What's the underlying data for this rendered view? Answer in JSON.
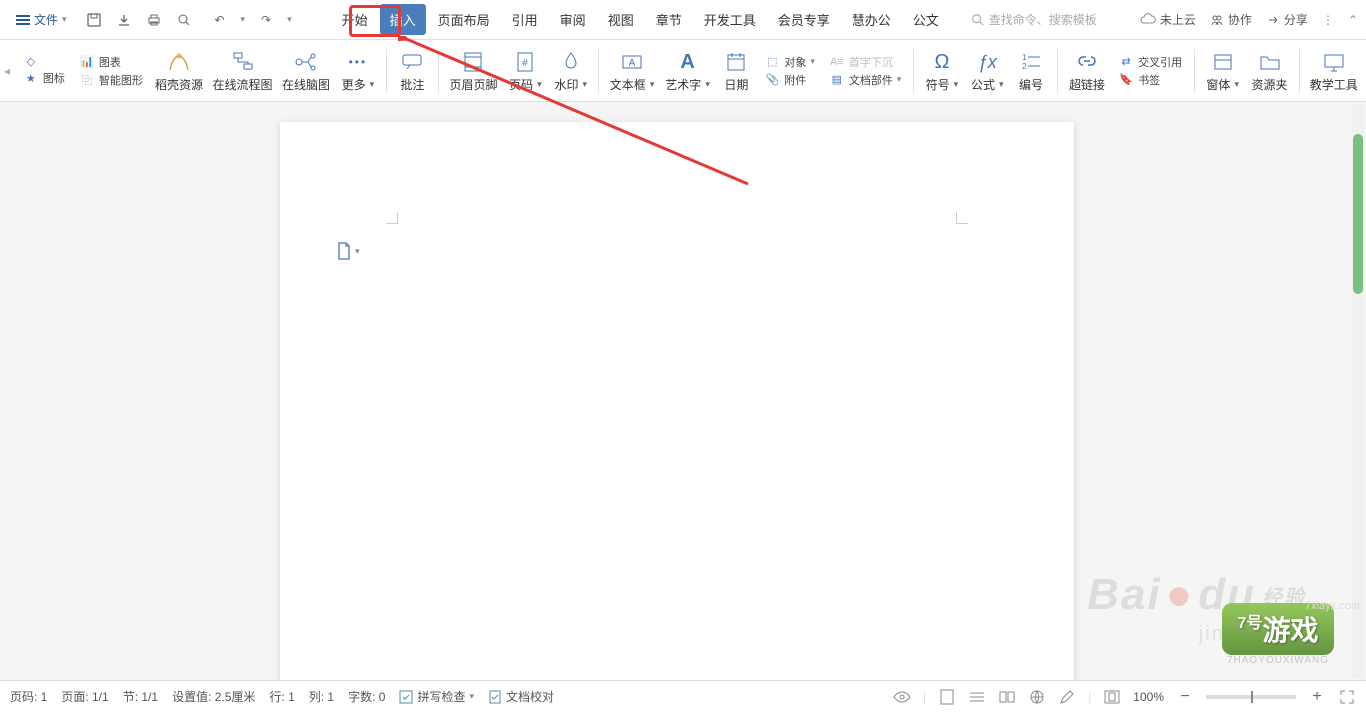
{
  "topbar": {
    "file_label": "文件",
    "tabs": [
      "开始",
      "插入",
      "页面布局",
      "引用",
      "审阅",
      "视图",
      "章节",
      "开发工具",
      "会员专享",
      "慧办公",
      "公文"
    ],
    "active_tab_index": 1,
    "search_placeholder": "查找命令、搜索模板",
    "cloud_label": "未上云",
    "collab_label": "协作",
    "share_label": "分享"
  },
  "ribbon": {
    "items": [
      {
        "label": "图标"
      },
      {
        "label": "智能图形"
      },
      {
        "label": "稻壳资源"
      },
      {
        "label": "在线流程图"
      },
      {
        "label": "在线脑图"
      },
      {
        "label": "更多"
      },
      {
        "label": "批注"
      },
      {
        "label": "页眉页脚"
      },
      {
        "label": "页码"
      },
      {
        "label": "水印"
      },
      {
        "label": "文本框"
      },
      {
        "label": "艺术字"
      },
      {
        "label": "日期"
      },
      {
        "label": "符号"
      },
      {
        "label": "公式"
      },
      {
        "label": "编号"
      },
      {
        "label": "超链接"
      },
      {
        "label": "窗体"
      },
      {
        "label": "资源夹"
      },
      {
        "label": "教学工具"
      }
    ],
    "chart_label": "图表",
    "side": {
      "object": "对象",
      "attachment": "附件",
      "docpart": "文档部件",
      "dropcap": "首字下沉",
      "crossref": "交叉引用",
      "bookmark": "书签"
    }
  },
  "statusbar": {
    "page_no": "页码: 1",
    "page_of": "页面: 1/1",
    "section": "节: 1/1",
    "setval": "设置值: 2.5厘米",
    "row": "行: 1",
    "col": "列: 1",
    "chars": "字数: 0",
    "spellcheck": "拼写检查",
    "doccheck": "文档校对",
    "zoom": "100%"
  },
  "watermarks": {
    "baidu": "Bai",
    "baidu2": "du",
    "baidu_exp": "经验",
    "baidu_url": "jingyan.ba",
    "game": "游戏",
    "game_sub": "7HAOYOUXIWANG",
    "game_dom": "7xiayx.com",
    "game_prefix": "7号"
  }
}
